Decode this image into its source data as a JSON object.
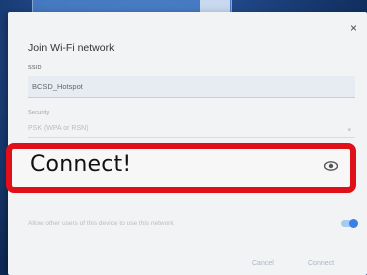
{
  "dialog": {
    "title": "Join Wi-Fi network",
    "ssid_label": "SSID",
    "ssid_value": "BCSD_Hotspot",
    "security_label": "Security",
    "security_value": "PSK (WPA or RSN)",
    "password_value": "Connect!",
    "allow_label": "Allow other users of this device to use this network",
    "cancel_label": "Cancel",
    "connect_label": "Connect",
    "close_glyph": "×",
    "caret_glyph": "▾"
  },
  "icons": {
    "close": "close-icon",
    "eye": "eye-icon",
    "caret": "chevron-down-icon"
  },
  "colors": {
    "highlight_border": "#e0101a",
    "accent": "#3b80e4"
  },
  "toggle": {
    "allow_other_users": true
  }
}
